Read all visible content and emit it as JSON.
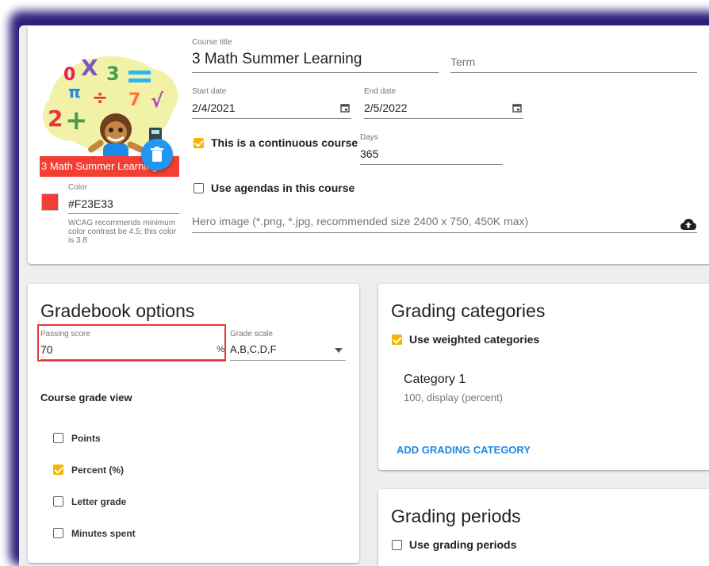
{
  "course": {
    "image_caption": "3 Math Summer Learning",
    "color_label": "Color",
    "color_value": "#F23E33",
    "color_hint": "WCAG recommends minimum color contrast be 4.5; this color is 3.8",
    "title_label": "Course title",
    "title_value": "3 Math Summer Learning",
    "term_placeholder": "Term",
    "start_label": "Start date",
    "start_value": "2/4/2021",
    "end_label": "End date",
    "end_value": "2/5/2022",
    "continuous_label": "This is a continuous course",
    "continuous_checked": true,
    "days_label": "Days",
    "days_value": "365",
    "agendas_label": "Use agendas in this course",
    "agendas_checked": false,
    "hero_placeholder": "Hero image (*.png, *.jpg, recommended size 2400 x 750, 450K max)",
    "accent_color": "#F23E33"
  },
  "gradebook": {
    "title": "Gradebook options",
    "passing_label": "Passing score",
    "passing_value": "70",
    "passing_suffix": "%",
    "scale_label": "Grade scale",
    "scale_value": "A,B,C,D,F",
    "view_title": "Course grade view",
    "options": [
      {
        "label": "Points",
        "checked": false
      },
      {
        "label": "Percent (%)",
        "checked": true
      },
      {
        "label": "Letter grade",
        "checked": false
      },
      {
        "label": "Minutes spent",
        "checked": false
      }
    ]
  },
  "categories": {
    "title": "Grading categories",
    "weighted_label": "Use weighted categories",
    "weighted_checked": true,
    "items": [
      {
        "name": "Category 1",
        "detail": "100, display (percent)"
      }
    ],
    "add_label": "ADD GRADING CATEGORY"
  },
  "periods": {
    "title": "Grading periods",
    "use_label": "Use grading periods",
    "use_checked": false
  },
  "colors": {
    "checkbox_accent": "#F5B400",
    "link_blue": "#1E88E5",
    "fab_blue": "#2196F3",
    "highlight_red": "#E53935"
  }
}
